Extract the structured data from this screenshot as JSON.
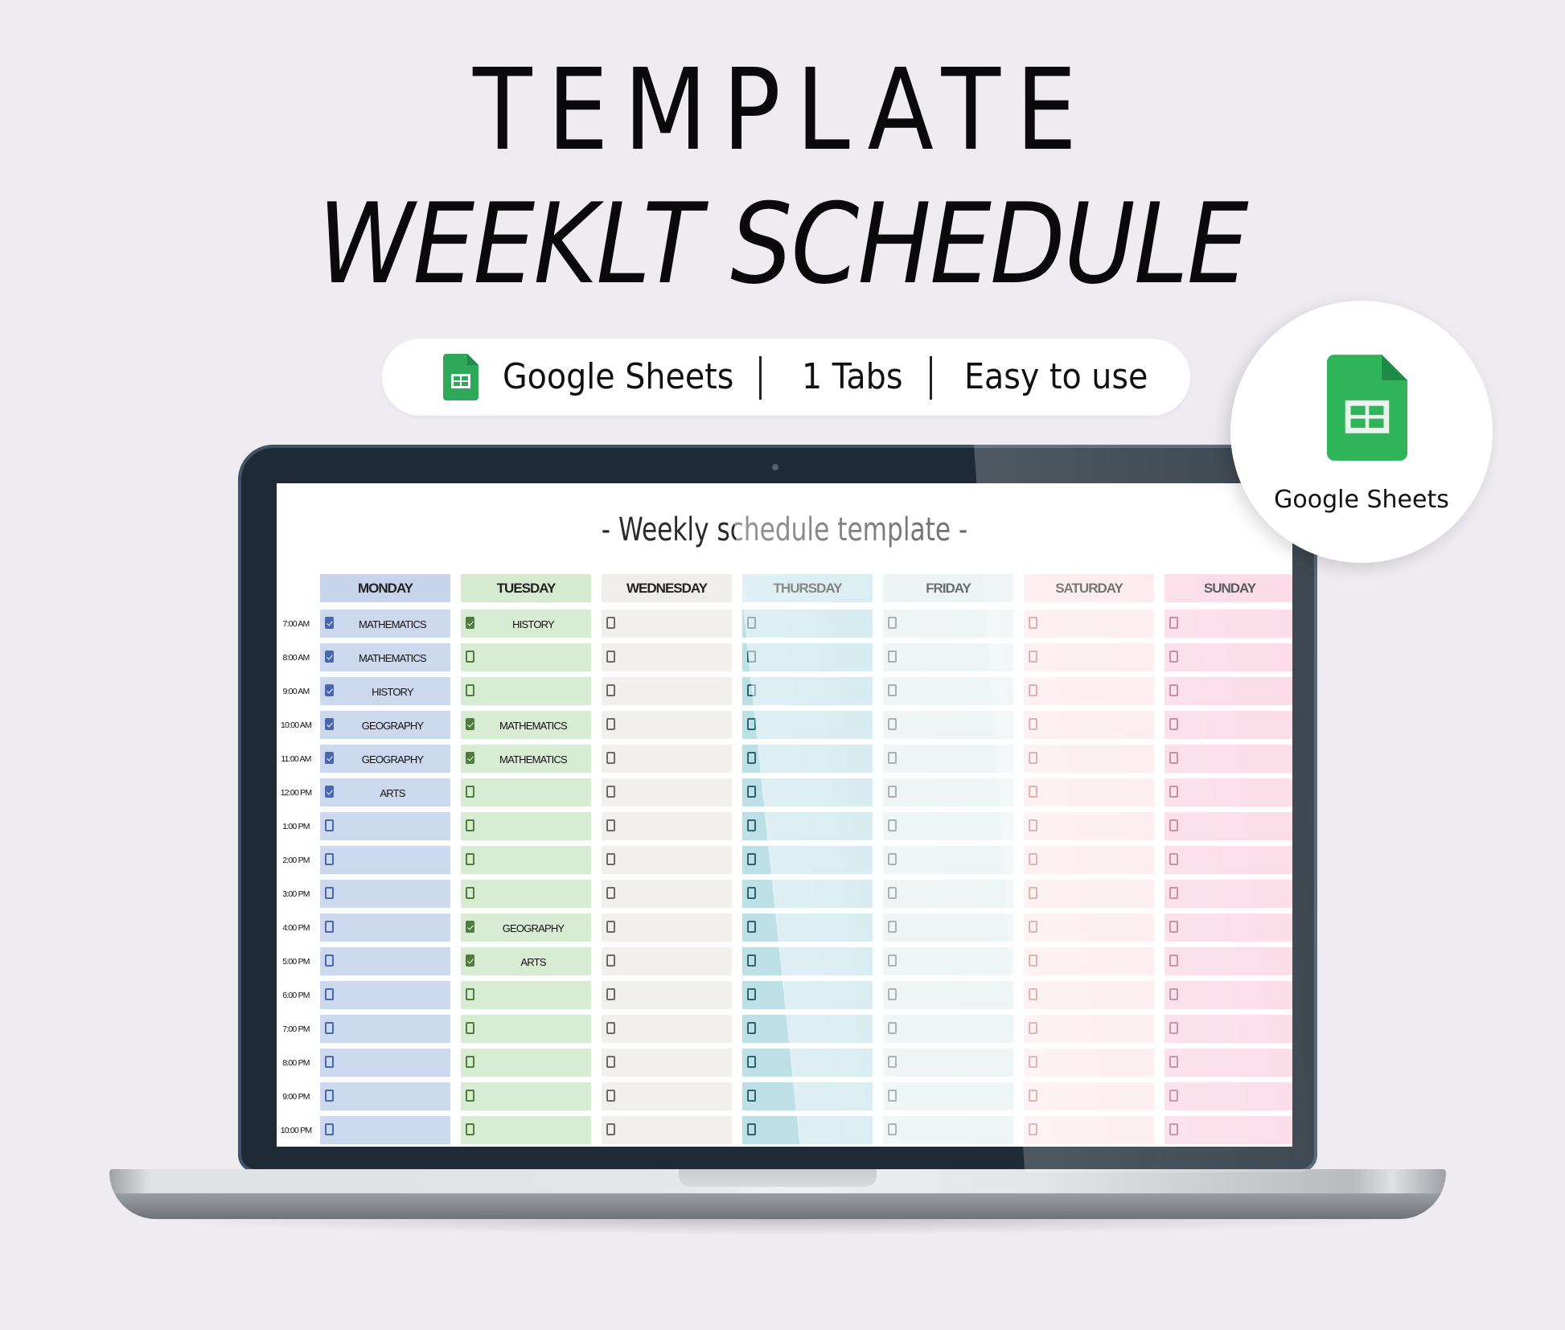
{
  "headline": {
    "line1": "TEMPLATE",
    "line2": "WEEKLT SCHEDULE"
  },
  "feature_pill": {
    "icon": "google-sheets-icon",
    "items": [
      "Google Sheets",
      "1 Tabs",
      "Easy to use"
    ]
  },
  "badge": {
    "icon": "google-sheets-icon",
    "label": "Google Sheets"
  },
  "colors": {
    "sheets_green": "#2fa85a",
    "sheets_green_dark": "#1e8a46",
    "laptop_bezel": "#1e2a35",
    "background": "#efecf1"
  },
  "spreadsheet": {
    "title": "- Weekly schedule template -",
    "times": [
      "7:00 AM",
      "8:00 AM",
      "9:00 AM",
      "10:00 AM",
      "11:00 AM",
      "12:00 PM",
      "1:00 PM",
      "2:00 PM",
      "3:00 PM",
      "4:00 PM",
      "5:00 PM",
      "6:00 PM",
      "7:00 PM",
      "8:00 PM",
      "9:00 PM",
      "10:00 PM"
    ],
    "days": [
      {
        "name": "MONDAY",
        "bg": "#ccd8ee",
        "head_bg": "#c8d4ec",
        "checkbox": "#4a67ad",
        "slots": [
          {
            "checked": true,
            "text": "MATHEMATICS"
          },
          {
            "checked": true,
            "text": "MATHEMATICS"
          },
          {
            "checked": true,
            "text": "HISTORY"
          },
          {
            "checked": true,
            "text": "GEOGRAPHY"
          },
          {
            "checked": true,
            "text": "GEOGRAPHY"
          },
          {
            "checked": true,
            "text": "ARTS"
          },
          {
            "checked": false,
            "text": ""
          },
          {
            "checked": false,
            "text": ""
          },
          {
            "checked": false,
            "text": ""
          },
          {
            "checked": false,
            "text": ""
          },
          {
            "checked": false,
            "text": ""
          },
          {
            "checked": false,
            "text": ""
          },
          {
            "checked": false,
            "text": ""
          },
          {
            "checked": false,
            "text": ""
          },
          {
            "checked": false,
            "text": ""
          },
          {
            "checked": false,
            "text": ""
          }
        ]
      },
      {
        "name": "TUESDAY",
        "bg": "#d8ebd3",
        "head_bg": "#d6eacf",
        "checkbox": "#4e7d3c",
        "slots": [
          {
            "checked": true,
            "text": "HISTORY"
          },
          {
            "checked": false,
            "text": ""
          },
          {
            "checked": false,
            "text": ""
          },
          {
            "checked": true,
            "text": "MATHEMATICS"
          },
          {
            "checked": true,
            "text": "MATHEMATICS"
          },
          {
            "checked": false,
            "text": ""
          },
          {
            "checked": false,
            "text": ""
          },
          {
            "checked": false,
            "text": ""
          },
          {
            "checked": false,
            "text": ""
          },
          {
            "checked": true,
            "text": "GEOGRAPHY"
          },
          {
            "checked": true,
            "text": "ARTS"
          },
          {
            "checked": false,
            "text": ""
          },
          {
            "checked": false,
            "text": ""
          },
          {
            "checked": false,
            "text": ""
          },
          {
            "checked": false,
            "text": ""
          },
          {
            "checked": false,
            "text": ""
          }
        ]
      },
      {
        "name": "WEDNESDAY",
        "bg": "#f2f0ed",
        "head_bg": "#f0eeeb",
        "checkbox": "#6e6a66",
        "slots": [
          {
            "checked": false,
            "text": ""
          },
          {
            "checked": false,
            "text": ""
          },
          {
            "checked": false,
            "text": ""
          },
          {
            "checked": false,
            "text": ""
          },
          {
            "checked": false,
            "text": ""
          },
          {
            "checked": false,
            "text": ""
          },
          {
            "checked": false,
            "text": ""
          },
          {
            "checked": false,
            "text": ""
          },
          {
            "checked": false,
            "text": ""
          },
          {
            "checked": false,
            "text": ""
          },
          {
            "checked": false,
            "text": ""
          },
          {
            "checked": false,
            "text": ""
          },
          {
            "checked": false,
            "text": ""
          },
          {
            "checked": false,
            "text": ""
          },
          {
            "checked": false,
            "text": ""
          },
          {
            "checked": false,
            "text": ""
          }
        ]
      },
      {
        "name": "THURSDAY",
        "bg": "#bde0e7",
        "head_bg": "#c2e2e9",
        "checkbox": "#2f6170",
        "slots": [
          {
            "checked": false,
            "text": ""
          },
          {
            "checked": false,
            "text": ""
          },
          {
            "checked": false,
            "text": ""
          },
          {
            "checked": false,
            "text": ""
          },
          {
            "checked": false,
            "text": ""
          },
          {
            "checked": false,
            "text": ""
          },
          {
            "checked": false,
            "text": ""
          },
          {
            "checked": false,
            "text": ""
          },
          {
            "checked": false,
            "text": ""
          },
          {
            "checked": false,
            "text": ""
          },
          {
            "checked": false,
            "text": ""
          },
          {
            "checked": false,
            "text": ""
          },
          {
            "checked": false,
            "text": ""
          },
          {
            "checked": false,
            "text": ""
          },
          {
            "checked": false,
            "text": ""
          },
          {
            "checked": false,
            "text": ""
          }
        ]
      },
      {
        "name": "FRIDAY",
        "bg": "#e6f0f0",
        "head_bg": "#e4eeee",
        "checkbox": "#6f7f7f",
        "slots": [
          {
            "checked": false,
            "text": ""
          },
          {
            "checked": false,
            "text": ""
          },
          {
            "checked": false,
            "text": ""
          },
          {
            "checked": false,
            "text": ""
          },
          {
            "checked": false,
            "text": ""
          },
          {
            "checked": false,
            "text": ""
          },
          {
            "checked": false,
            "text": ""
          },
          {
            "checked": false,
            "text": ""
          },
          {
            "checked": false,
            "text": ""
          },
          {
            "checked": false,
            "text": ""
          },
          {
            "checked": false,
            "text": ""
          },
          {
            "checked": false,
            "text": ""
          },
          {
            "checked": false,
            "text": ""
          },
          {
            "checked": false,
            "text": ""
          },
          {
            "checked": false,
            "text": ""
          },
          {
            "checked": false,
            "text": ""
          }
        ]
      },
      {
        "name": "SATURDAY",
        "bg": "#fde6ea",
        "head_bg": "#fce3e8",
        "checkbox": "#c9786c",
        "slots": [
          {
            "checked": false,
            "text": ""
          },
          {
            "checked": false,
            "text": ""
          },
          {
            "checked": false,
            "text": ""
          },
          {
            "checked": false,
            "text": ""
          },
          {
            "checked": false,
            "text": ""
          },
          {
            "checked": false,
            "text": ""
          },
          {
            "checked": false,
            "text": ""
          },
          {
            "checked": false,
            "text": ""
          },
          {
            "checked": false,
            "text": ""
          },
          {
            "checked": false,
            "text": ""
          },
          {
            "checked": false,
            "text": ""
          },
          {
            "checked": false,
            "text": ""
          },
          {
            "checked": false,
            "text": ""
          },
          {
            "checked": false,
            "text": ""
          },
          {
            "checked": false,
            "text": ""
          },
          {
            "checked": false,
            "text": ""
          }
        ]
      },
      {
        "name": "SUNDAY",
        "bg": "#fad3e2",
        "head_bg": "#f9d2e1",
        "checkbox": "#b25b79",
        "slots": [
          {
            "checked": false,
            "text": ""
          },
          {
            "checked": false,
            "text": ""
          },
          {
            "checked": false,
            "text": ""
          },
          {
            "checked": false,
            "text": ""
          },
          {
            "checked": false,
            "text": ""
          },
          {
            "checked": false,
            "text": ""
          },
          {
            "checked": false,
            "text": ""
          },
          {
            "checked": false,
            "text": ""
          },
          {
            "checked": false,
            "text": ""
          },
          {
            "checked": false,
            "text": ""
          },
          {
            "checked": false,
            "text": ""
          },
          {
            "checked": false,
            "text": ""
          },
          {
            "checked": false,
            "text": ""
          },
          {
            "checked": false,
            "text": ""
          },
          {
            "checked": false,
            "text": ""
          },
          {
            "checked": false,
            "text": ""
          }
        ]
      }
    ]
  }
}
